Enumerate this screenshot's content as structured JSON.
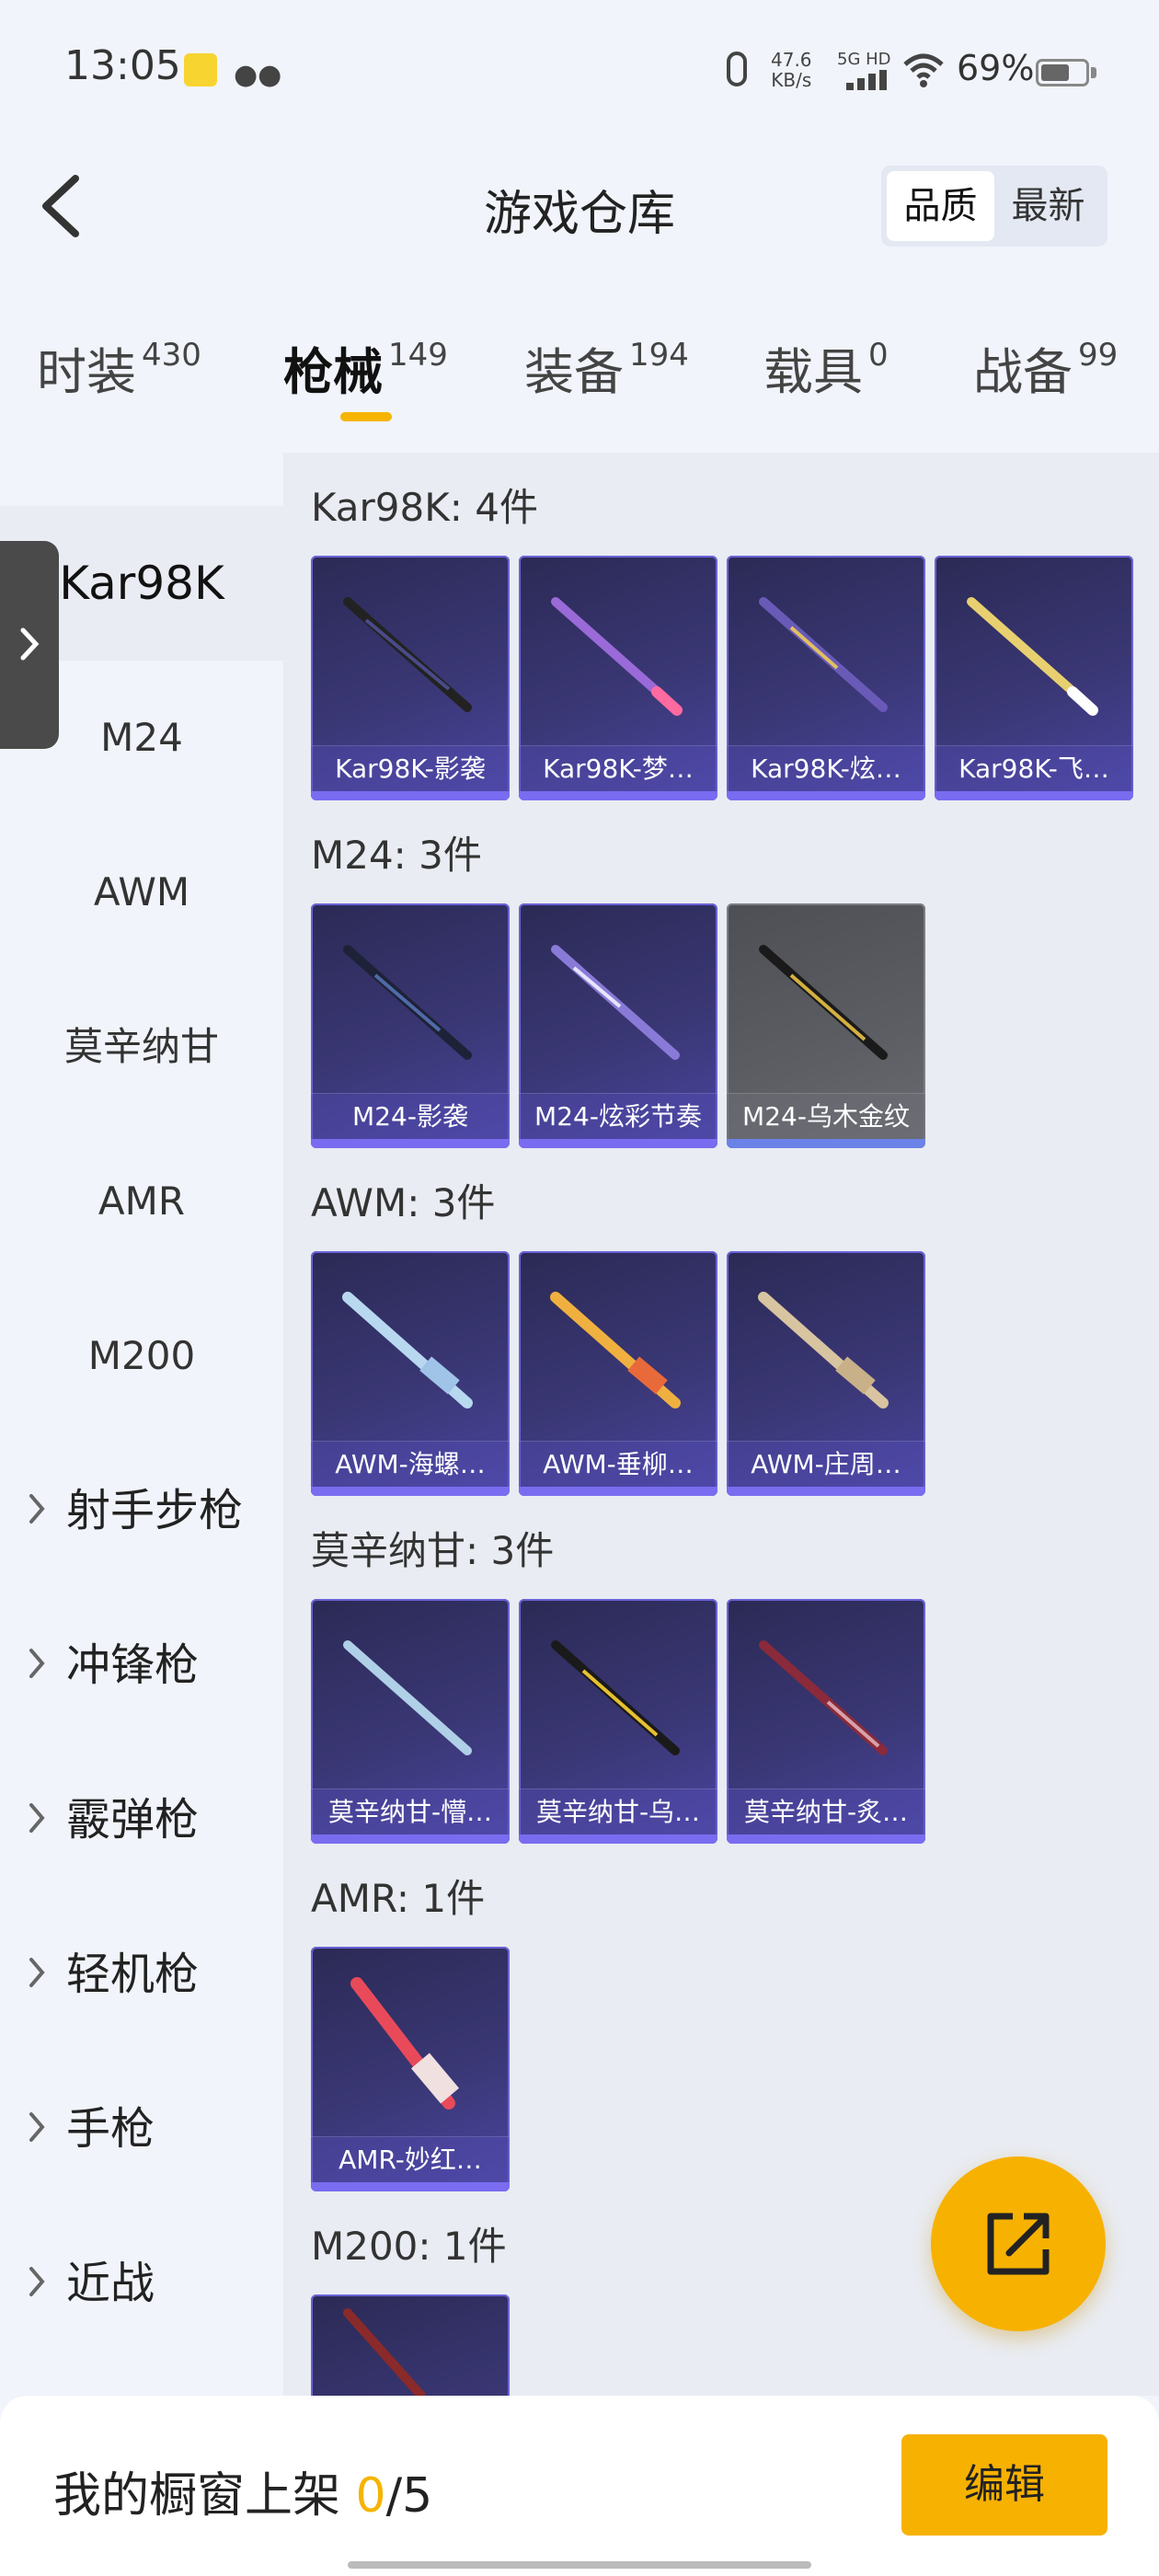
{
  "status_bar": {
    "time": "13:05",
    "net_speed_value": "47.6",
    "net_speed_unit": "KB/s",
    "network": "5G HD",
    "battery": "69%"
  },
  "header": {
    "title": "游戏仓库",
    "sort_options": [
      "品质",
      "最新"
    ],
    "sort_selected": "品质"
  },
  "tabs": [
    {
      "label": "时装",
      "count": "430"
    },
    {
      "label": "枪械",
      "count": "149"
    },
    {
      "label": "装备",
      "count": "194"
    },
    {
      "label": "载具",
      "count": "0"
    },
    {
      "label": "战备",
      "count": "99"
    }
  ],
  "sidebar": {
    "subitems": [
      "Kar98K",
      "M24",
      "AWM",
      "莫辛纳甘",
      "AMR",
      "M200"
    ],
    "groups": [
      "射手步枪",
      "冲锋枪",
      "霰弹枪",
      "轻机枪",
      "手枪",
      "近战"
    ]
  },
  "sections": [
    {
      "title": "Kar98K: 4件",
      "items": [
        "Kar98K-影袭",
        "Kar98K-梦…",
        "Kar98K-炫…",
        "Kar98K-飞…"
      ]
    },
    {
      "title": "M24: 3件",
      "items": [
        "M24-影袭",
        "M24-炫彩节奏",
        "M24-乌木金纹"
      ]
    },
    {
      "title": "AWM: 3件",
      "items": [
        "AWM-海螺…",
        "AWM-垂柳…",
        "AWM-庄周…"
      ]
    },
    {
      "title": "莫辛纳甘: 3件",
      "items": [
        "莫辛纳甘-懵…",
        "莫辛纳甘-乌…",
        "莫辛纳甘-炙…"
      ]
    },
    {
      "title": "AMR: 1件",
      "items": [
        "AMR-妙红…"
      ]
    },
    {
      "title": "M200: 1件",
      "items": []
    }
  ],
  "bottom": {
    "showcase_label": "我的橱窗上架",
    "showcase_current": "0",
    "showcase_total": "/5",
    "edit_label": "编辑"
  },
  "colors": {
    "accent": "#f7b100",
    "card_purple": "#3a3775",
    "card_gray": "#5c5e64"
  }
}
